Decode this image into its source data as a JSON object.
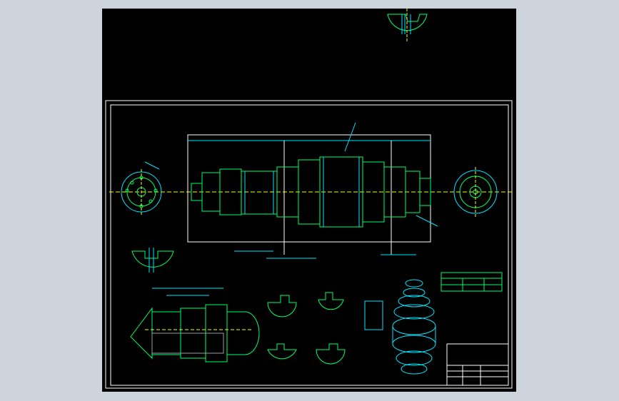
{
  "colors": {
    "background": "#cdd4dc",
    "canvas": "#000000",
    "border": "#ffffff",
    "part": "#00ff66",
    "dim": "#00e5ff",
    "center": "#ffff00",
    "note": "#ff33ff",
    "hatch": "#9aa0a6"
  },
  "drawing": {
    "views": [
      "top-detail-section",
      "left-end-view",
      "main-elevation",
      "right-end-view",
      "section-views",
      "shaft-detail",
      "iso-3d-view",
      "spec-table",
      "title-block"
    ]
  }
}
